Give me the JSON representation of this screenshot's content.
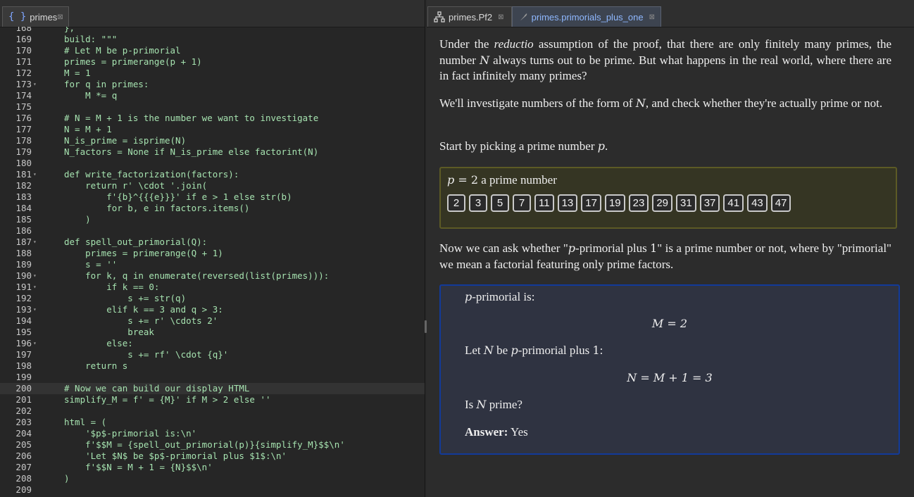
{
  "left_tab": {
    "icon": "{ }",
    "label": "primes",
    "close": "⊠"
  },
  "right_tabs": [
    {
      "label": "primes.Pf2",
      "close": "⊠"
    },
    {
      "label": "primes.primorials_plus_one",
      "close": "⊠"
    }
  ],
  "code_lines": [
    {
      "n": "168",
      "t": "},",
      "fold": ""
    },
    {
      "n": "169",
      "t": "build: \"\"\"",
      "fold": ""
    },
    {
      "n": "170",
      "t": "# Let M be p-primorial",
      "fold": ""
    },
    {
      "n": "171",
      "t": "primes = primerange(p + 1)",
      "fold": ""
    },
    {
      "n": "172",
      "t": "M = 1",
      "fold": ""
    },
    {
      "n": "173",
      "t": "for q in primes:",
      "fold": "▾"
    },
    {
      "n": "174",
      "t": "    M *= q",
      "fold": ""
    },
    {
      "n": "175",
      "t": "",
      "fold": ""
    },
    {
      "n": "176",
      "t": "# N = M + 1 is the number we want to investigate",
      "fold": ""
    },
    {
      "n": "177",
      "t": "N = M + 1",
      "fold": ""
    },
    {
      "n": "178",
      "t": "N_is_prime = isprime(N)",
      "fold": ""
    },
    {
      "n": "179",
      "t": "N_factors = None if N_is_prime else factorint(N)",
      "fold": ""
    },
    {
      "n": "180",
      "t": "",
      "fold": ""
    },
    {
      "n": "181",
      "t": "def write_factorization(factors):",
      "fold": "▾"
    },
    {
      "n": "182",
      "t": "    return r' \\cdot '.join(",
      "fold": ""
    },
    {
      "n": "183",
      "t": "        f'{b}^{{{e}}}' if e > 1 else str(b)",
      "fold": ""
    },
    {
      "n": "184",
      "t": "        for b, e in factors.items()",
      "fold": ""
    },
    {
      "n": "185",
      "t": "    )",
      "fold": ""
    },
    {
      "n": "186",
      "t": "",
      "fold": ""
    },
    {
      "n": "187",
      "t": "def spell_out_primorial(Q):",
      "fold": "▾"
    },
    {
      "n": "188",
      "t": "    primes = primerange(Q + 1)",
      "fold": ""
    },
    {
      "n": "189",
      "t": "    s = ''",
      "fold": ""
    },
    {
      "n": "190",
      "t": "    for k, q in enumerate(reversed(list(primes))):",
      "fold": "▾"
    },
    {
      "n": "191",
      "t": "        if k == 0:",
      "fold": "▾"
    },
    {
      "n": "192",
      "t": "            s += str(q)",
      "fold": ""
    },
    {
      "n": "193",
      "t": "        elif k == 3 and q > 3:",
      "fold": "▾"
    },
    {
      "n": "194",
      "t": "            s += r' \\cdots 2'",
      "fold": ""
    },
    {
      "n": "195",
      "t": "            break",
      "fold": ""
    },
    {
      "n": "196",
      "t": "        else:",
      "fold": "▾"
    },
    {
      "n": "197",
      "t": "            s += rf' \\cdot {q}'",
      "fold": ""
    },
    {
      "n": "198",
      "t": "    return s",
      "fold": ""
    },
    {
      "n": "199",
      "t": "",
      "fold": ""
    },
    {
      "n": "200",
      "t": "# Now we can build our display HTML",
      "fold": "",
      "current": true
    },
    {
      "n": "201",
      "t": "simplify_M = f' = {M}' if M > 2 else ''",
      "fold": ""
    },
    {
      "n": "202",
      "t": "",
      "fold": ""
    },
    {
      "n": "203",
      "t": "html = (",
      "fold": ""
    },
    {
      "n": "204",
      "t": "    '$p$-primorial is:\\n'",
      "fold": ""
    },
    {
      "n": "205",
      "t": "    f'$$M = {spell_out_primorial(p)}{simplify_M}$$\\n'",
      "fold": ""
    },
    {
      "n": "206",
      "t": "    'Let $N$ be $p$-primorial plus $1$:\\n'",
      "fold": ""
    },
    {
      "n": "207",
      "t": "    f'$$N = M + 1 = {N}$$\\n'",
      "fold": ""
    },
    {
      "n": "208",
      "t": ")",
      "fold": ""
    },
    {
      "n": "209",
      "t": "",
      "fold": ""
    }
  ],
  "content": {
    "p1_a": "Under the ",
    "p1_em": "reductio",
    "p1_b": " assumption of the proof, that there are only finitely many primes, the number ",
    "p1_N": "N",
    "p1_c": " always turns out to be prime. But what happens in the real world, where there are in fact infinitely many primes?",
    "p2_a": "We'll investigate numbers of the form of ",
    "p2_N": "N",
    "p2_b": ", and check whether they're actually prime or not.",
    "p3_a": "Start by picking a prime number ",
    "p3_p": "p",
    "p3_b": ".",
    "chooser_var": "p",
    "chooser_eq": " = 2",
    "chooser_text": " a prime number",
    "primes": [
      "2",
      "3",
      "5",
      "7",
      "11",
      "13",
      "17",
      "19",
      "23",
      "29",
      "31",
      "37",
      "41",
      "43",
      "47"
    ],
    "p4_a": "Now we can ask whether \"",
    "p4_p": "p",
    "p4_b": "-primorial plus ",
    "p4_one": "1",
    "p4_c": "\" is a prime number or not, where by \"primorial\" we mean a factorial featuring only prime factors.",
    "result": {
      "title_p": "p",
      "title_rest": "-primorial is:",
      "eq1": "M = 2",
      "let_a": "Let ",
      "let_N": "N",
      "let_b": " be ",
      "let_p": "p",
      "let_c": "-primorial plus ",
      "let_one": "1",
      "let_d": ":",
      "eq2": "N = M + 1 = 3",
      "is_a": "Is ",
      "is_N": "N",
      "is_b": " prime?",
      "answer_label": "Answer:",
      "answer_value": " Yes"
    }
  },
  "colors": {
    "accent_tab": "#8fb8ff",
    "code_text": "#a6e3b0",
    "chooser_border": "#5c5a25",
    "result_border": "#123a99"
  }
}
